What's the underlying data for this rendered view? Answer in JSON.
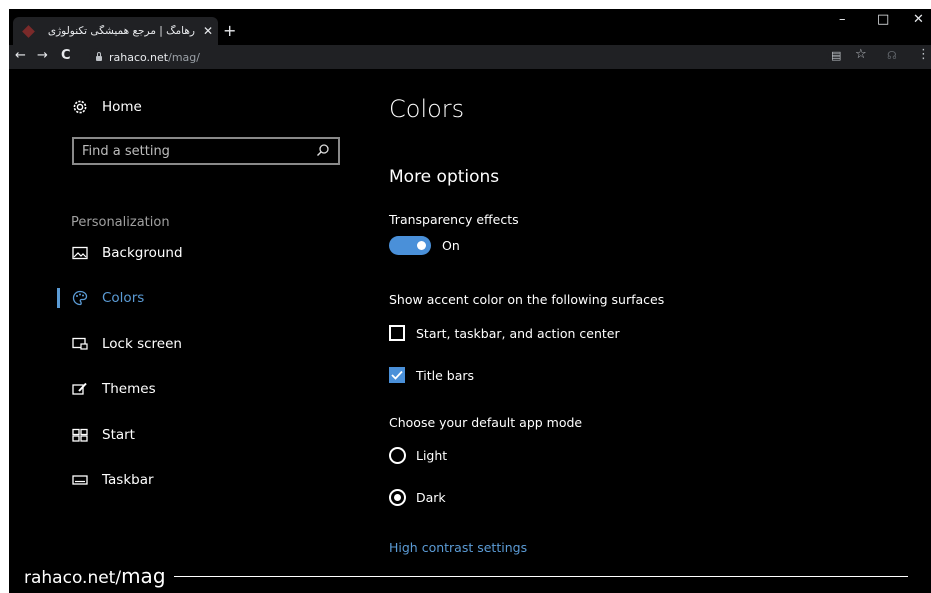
{
  "browser": {
    "tab_title": "رهامگ | مرجع همیشگی تکنولوژی |",
    "tab_close_glyph": "✕",
    "newtab_glyph": "+",
    "url_host": "rahaco.net",
    "url_path": "/mag/",
    "window_controls": {
      "minimize": "–",
      "maximize": "□",
      "close": "✕"
    },
    "nav": {
      "back": "←",
      "forward": "→",
      "reload": "C"
    },
    "toolbar_icons": [
      "translate-icon",
      "bookmark-star-icon",
      "extension-icon",
      "menu-icon"
    ],
    "toolbar_glyphs": {
      "translate": "▤",
      "star": "☆",
      "extension": "☊",
      "menu": "⋮"
    }
  },
  "settings": {
    "home_label": "Home",
    "search_placeholder": "Find a setting",
    "section": "Personalization",
    "nav_items": [
      {
        "label": "Background",
        "icon": "picture-icon"
      },
      {
        "label": "Colors",
        "icon": "palette-icon",
        "selected": true
      },
      {
        "label": "Lock screen",
        "icon": "lock-screen-icon"
      },
      {
        "label": "Themes",
        "icon": "brush-icon"
      },
      {
        "label": "Start",
        "icon": "start-grid-icon"
      },
      {
        "label": "Taskbar",
        "icon": "taskbar-icon"
      }
    ],
    "page_title": "Colors",
    "more_options": "More options",
    "transparency_label": "Transparency effects",
    "transparency_state": "On",
    "accent_label": "Show accent color on the following surfaces",
    "accent_options": [
      {
        "label": "Start, taskbar, and action center",
        "checked": false
      },
      {
        "label": "Title bars",
        "checked": true
      }
    ],
    "app_mode_label": "Choose your default app mode",
    "app_modes": [
      {
        "label": "Light",
        "checked": false
      },
      {
        "label": "Dark",
        "checked": true
      }
    ],
    "high_contrast_link": "High contrast settings"
  },
  "watermark": {
    "prefix": "rahaco.net/",
    "suffix": "mag"
  },
  "colors": {
    "accent": "#4a90d9",
    "link": "#5b9bd5",
    "background": "#000000",
    "chrome": "#202124"
  }
}
